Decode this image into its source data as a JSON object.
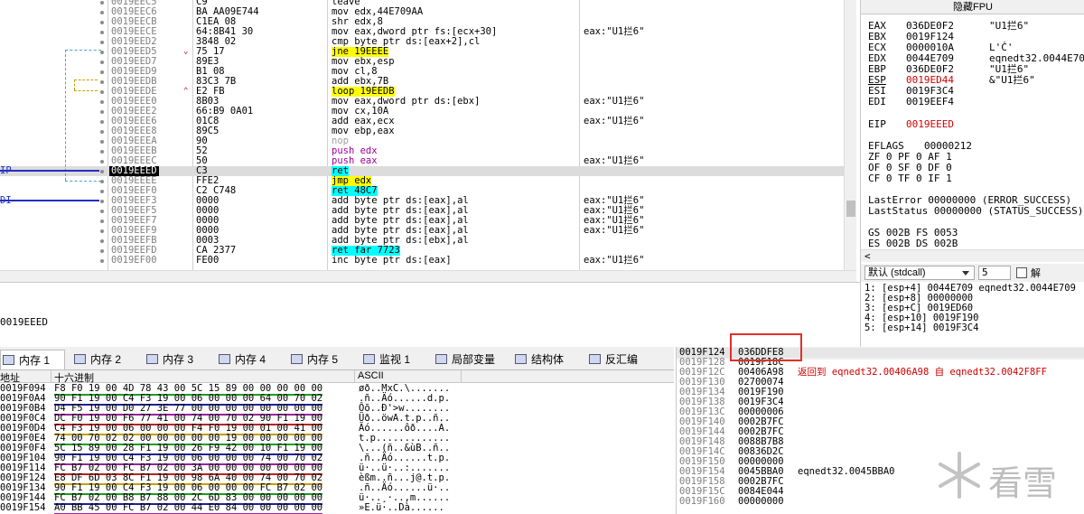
{
  "disasm": {
    "rows": [
      {
        "addr": "0019EEC5",
        "bytes": "C9",
        "asm": "leave",
        "cmt": ""
      },
      {
        "addr": "0019EEC6",
        "bytes": "BA AA09E744",
        "asm": "mov edx,44E709AA",
        "cmt": ""
      },
      {
        "addr": "0019EECB",
        "bytes": "C1EA 08",
        "asm": "shr edx,8",
        "cmt": ""
      },
      {
        "addr": "0019EECE",
        "bytes": "64:8B41 30",
        "asm": "mov eax,dword ptr fs:[ecx+30]",
        "cmt": "eax:\"U1拦6\""
      },
      {
        "addr": "0019EED2",
        "bytes": "3848 02",
        "asm": "cmp byte ptr ds:[eax+2],cl",
        "cmt": ""
      },
      {
        "addr": "0019EED5",
        "bytes": "75 17",
        "asm": "jne 19EEEE",
        "cmt": ""
      },
      {
        "addr": "0019EED7",
        "bytes": "89E3",
        "asm": "mov ebx,esp",
        "cmt": ""
      },
      {
        "addr": "0019EED9",
        "bytes": "B1 08",
        "asm": "mov cl,8",
        "cmt": ""
      },
      {
        "addr": "0019EEDB",
        "bytes": "83C3 7B",
        "asm": "add ebx,7B",
        "cmt": ""
      },
      {
        "addr": "0019EEDE",
        "bytes": "E2 FB",
        "asm": "loop 19EEDB",
        "cmt": ""
      },
      {
        "addr": "0019EEE0",
        "bytes": "8B03",
        "asm": "mov eax,dword ptr ds:[ebx]",
        "cmt": "eax:\"U1拦6\""
      },
      {
        "addr": "0019EEE2",
        "bytes": "66:B9 0A01",
        "asm": "mov cx,10A",
        "cmt": ""
      },
      {
        "addr": "0019EEE6",
        "bytes": "01C8",
        "asm": "add eax,ecx",
        "cmt": "eax:\"U1拦6\""
      },
      {
        "addr": "0019EEE8",
        "bytes": "89C5",
        "asm": "mov ebp,eax",
        "cmt": ""
      },
      {
        "addr": "0019EEEA",
        "bytes": "90",
        "asm": "nop",
        "cmt": ""
      },
      {
        "addr": "0019EEEB",
        "bytes": "52",
        "asm": "push edx",
        "cmt": ""
      },
      {
        "addr": "0019EEEC",
        "bytes": "50",
        "asm": "push eax",
        "cmt": "eax:\"U1拦6\""
      },
      {
        "addr": "0019EEED",
        "bytes": "C3",
        "asm": "ret",
        "cmt": ""
      },
      {
        "addr": "0019EEEE",
        "bytes": "FFE2",
        "asm": "jmp edx",
        "cmt": ""
      },
      {
        "addr": "0019EEF0",
        "bytes": "C2 C748",
        "asm": "ret 48C7",
        "cmt": ""
      },
      {
        "addr": "0019EEF3",
        "bytes": "0000",
        "asm": "add byte ptr ds:[eax],al",
        "cmt": "eax:\"U1拦6\""
      },
      {
        "addr": "0019EEF5",
        "bytes": "0000",
        "asm": "add byte ptr ds:[eax],al",
        "cmt": "eax:\"U1拦6\""
      },
      {
        "addr": "0019EEF7",
        "bytes": "0000",
        "asm": "add byte ptr ds:[eax],al",
        "cmt": "eax:\"U1拦6\""
      },
      {
        "addr": "0019EEF9",
        "bytes": "0000",
        "asm": "add byte ptr ds:[eax],al",
        "cmt": "eax:\"U1拦6\""
      },
      {
        "addr": "0019EEFB",
        "bytes": "0003",
        "asm": "add byte ptr ds:[ebx],al",
        "cmt": ""
      },
      {
        "addr": "0019EEFD",
        "bytes": "CA 2377",
        "asm": "ret far 7723",
        "cmt": ""
      },
      {
        "addr": "0019EF00",
        "bytes": "FE00",
        "asm": "inc byte ptr ds:[eax]",
        "cmt": "eax:\"U1拦6\""
      }
    ],
    "eip_label": "IP",
    "edi_label": "DI"
  },
  "regs": {
    "title": "隐藏FPU",
    "lines": [
      [
        "EAX",
        "036DE0F2",
        "\"U1拦6\""
      ],
      [
        "EBX",
        "0019F124",
        ""
      ],
      [
        "ECX",
        "0000010A",
        "L'Ċ'"
      ],
      [
        "EDX",
        "0044E709",
        "eqnedt32.0044E709"
      ],
      [
        "EBP",
        "036DE0F2",
        "\"U1拦6\""
      ],
      [
        "ESP",
        "0019ED44",
        "&\"U1拦6\""
      ],
      [
        "ESI",
        "0019F3C4",
        ""
      ],
      [
        "EDI",
        "0019EEF4",
        ""
      ]
    ],
    "eip": [
      "EIP",
      "0019EEED"
    ],
    "eflags": [
      "EFLAGS",
      "00000212"
    ],
    "flags": [
      "ZF 0  PF 0  AF 1",
      "OF 0  SF 0  DF 0",
      "CF 0  TF 0  IF 1"
    ],
    "lasterror": "LastError  00000000 (ERROR_SUCCESS)",
    "laststatus": "LastStatus 00000000 (STATUS_SUCCESS)",
    "segs": [
      "GS 002B  FS 0053",
      "ES 002B  DS 002B"
    ],
    "callconv": "默认 (stdcall)",
    "argcount": "5",
    "unlock": "解",
    "args": [
      "1: [esp+4] 0044E709 eqnedt32.0044E709",
      "2: [esp+8] 00000000",
      "3: [esp+C] 0019ED60",
      "4: [esp+10] 0019F190",
      "5: [esp+14] 0019F3C4"
    ]
  },
  "info": {
    "text": "0019EEED"
  },
  "tabs": [
    {
      "label": "内存 1"
    },
    {
      "label": "内存 2"
    },
    {
      "label": "内存 3"
    },
    {
      "label": "内存 4"
    },
    {
      "label": "内存 5"
    },
    {
      "label": "监视 1"
    },
    {
      "label": "局部变量"
    },
    {
      "label": "结构体"
    },
    {
      "label": "反汇编"
    }
  ],
  "hex": {
    "col_addr": "地址",
    "col_hex": "十六进制",
    "col_ascii": "ASCII",
    "rows": [
      [
        "0019F094",
        "F8 F0 19 00  4D 78 43 00  5C 15 89 00  00 00 00 00",
        "øð..MxC.\\......."
      ],
      [
        "0019F0A4",
        "90 F1 19 00  C4 F3 19 00  06 00 00 00  64 00 70 02",
        ".ñ..Äó......d.p."
      ],
      [
        "0019F0B4",
        "D4 F5 19 00  D0 27 3E 77  00 00 00 00  00 00 00 00",
        "Ôõ..Ð'>w........"
      ],
      [
        "0019F0C4",
        "DC F0 19 00  F6 77 41 00  74 00 70 02  90 F1 19 00",
        "Üð..öwA.t.p..ñ.."
      ],
      [
        "0019F0D4",
        "C4 F3 19 00  06 00 00 00  F4 F0 19 00  01 00 41 00",
        "Äó......ôð....A."
      ],
      [
        "0019F0E4",
        "74 00 70 02  02 00 00 00  00 00 19 00  00 00 00 00",
        "t.p............."
      ],
      [
        "0019F0F4",
        "5C 15 89 00  28 F1 19 00  26 F9 42 00  10 F1 19 00",
        "\\...(ñ..&ùB..ñ.."
      ],
      [
        "0019F104",
        "90 F1 19 00  C4 F3 19 00  06 00 00 00  74 00 70 02",
        ".ñ..Äó......t.p."
      ],
      [
        "0019F114",
        "FC B7 02 00  FC B7 02 00  3A 00 00 00  00 00 00 00",
        "ü·..ü·..:......."
      ],
      [
        "0019F124",
        "E8 DF 6D 03  8C F1 19 00  98 6A 40 00  74 00 70 02",
        "èßm..ñ...j@.t.p."
      ],
      [
        "0019F134",
        "90 F1 19 00  C4 F3 19 00  06 00 00 00  FC B7 02 00",
        ".ñ..Äó......ü·.."
      ],
      [
        "0019F144",
        "FC B7 02 00  B8 B7 88 00  2C 6D 83 00  00 00 00 00",
        "ü·..¸·..,m......"
      ],
      [
        "0019F154",
        "A0 BB 45 00  FC B7 02 00  44 E0 84 00  00 00 00 00",
        " »E.ü·..Dà......"
      ]
    ]
  },
  "stack": {
    "rows": [
      [
        "0019F124",
        "036DDFE8",
        ""
      ],
      [
        "0019F128",
        "0019F18C",
        ""
      ],
      [
        "0019F12C",
        "00406A98",
        "返回到 eqnedt32.00406A98 自 eqnedt32.0042F8FF"
      ],
      [
        "0019F130",
        "02700074",
        ""
      ],
      [
        "0019F134",
        "0019F190",
        ""
      ],
      [
        "0019F138",
        "0019F3C4",
        ""
      ],
      [
        "0019F13C",
        "00000006",
        ""
      ],
      [
        "0019F140",
        "0002B7FC",
        ""
      ],
      [
        "0019F144",
        "0002B7FC",
        ""
      ],
      [
        "0019F148",
        "0088B7B8",
        ""
      ],
      [
        "0019F14C",
        "00836D2C",
        ""
      ],
      [
        "0019F150",
        "00000000",
        ""
      ],
      [
        "0019F154",
        "0045BBA0",
        "eqnedt32.0045BBA0"
      ],
      [
        "0019F158",
        "0002B7FC",
        ""
      ],
      [
        "0019F15C",
        "0084E044",
        ""
      ],
      [
        "0019F160",
        "00000000",
        ""
      ]
    ]
  },
  "watermark": "看雪"
}
